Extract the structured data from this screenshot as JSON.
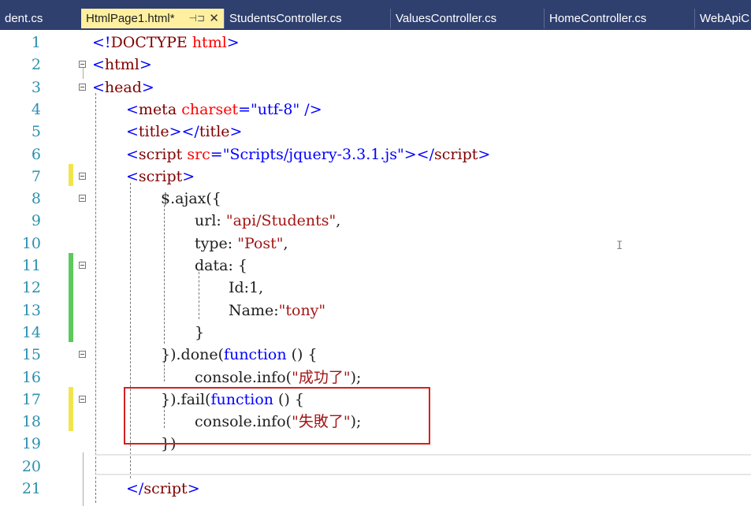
{
  "tabs": [
    {
      "label": "dent.cs",
      "active": false
    },
    {
      "label": "HtmlPage1.html*",
      "active": true
    },
    {
      "label": "StudentsController.cs",
      "active": false
    },
    {
      "label": "ValuesController.cs",
      "active": false
    },
    {
      "label": "HomeController.cs",
      "active": false
    },
    {
      "label": "WebApiC",
      "active": false
    }
  ],
  "tab_icons": {
    "pin": "pin-icon",
    "close": "close-icon"
  },
  "colors": {
    "tab_background": "#2f3f6e",
    "active_tab": "#fff0a0",
    "line_number": "#2b91af",
    "tag": "#0000ff",
    "tag_name": "#800000",
    "attribute": "#ff0000",
    "keyword": "#0000ff",
    "string": "#a31515",
    "modified_unsaved": "#f2e54c",
    "modified_saved": "#5cc95c",
    "highlight_box": "#d42020"
  },
  "code": {
    "line_numbers": [
      "1",
      "2",
      "3",
      "4",
      "5",
      "6",
      "7",
      "8",
      "9",
      "10",
      "11",
      "12",
      "13",
      "14",
      "15",
      "16",
      "17",
      "18",
      "19",
      "20",
      "21"
    ],
    "lines": [
      [
        {
          "t": "<!",
          "c": "t"
        },
        {
          "t": "DOCTYPE",
          "c": "tn"
        },
        {
          "t": " html",
          "c": "at"
        },
        {
          "t": ">",
          "c": "t"
        }
      ],
      [
        {
          "t": "<",
          "c": "t"
        },
        {
          "t": "html",
          "c": "tn"
        },
        {
          "t": ">",
          "c": "t"
        }
      ],
      [
        {
          "t": "<",
          "c": "t"
        },
        {
          "t": "head",
          "c": "tn"
        },
        {
          "t": ">",
          "c": "t"
        }
      ],
      [
        {
          "t": "<",
          "c": "t"
        },
        {
          "t": "meta",
          "c": "tn"
        },
        {
          "t": " charset",
          "c": "at"
        },
        {
          "t": "=",
          "c": "t"
        },
        {
          "t": "\"utf-8\"",
          "c": "av"
        },
        {
          "t": " />",
          "c": "t"
        }
      ],
      [
        {
          "t": "<",
          "c": "t"
        },
        {
          "t": "title",
          "c": "tn"
        },
        {
          "t": "></",
          "c": "t"
        },
        {
          "t": "title",
          "c": "tn"
        },
        {
          "t": ">",
          "c": "t"
        }
      ],
      [
        {
          "t": "<",
          "c": "t"
        },
        {
          "t": "script",
          "c": "tn"
        },
        {
          "t": " src",
          "c": "at"
        },
        {
          "t": "=",
          "c": "t"
        },
        {
          "t": "\"Scripts/jquery-3.3.1.js\"",
          "c": "av"
        },
        {
          "t": "></",
          "c": "t"
        },
        {
          "t": "script",
          "c": "tn"
        },
        {
          "t": ">",
          "c": "t"
        }
      ],
      [
        {
          "t": "<",
          "c": "t"
        },
        {
          "t": "script",
          "c": "tn"
        },
        {
          "t": ">",
          "c": "t"
        }
      ],
      [
        {
          "t": "$.ajax({",
          "c": ""
        }
      ],
      [
        {
          "t": "url: ",
          "c": ""
        },
        {
          "t": "\"api/Students\"",
          "c": "st"
        },
        {
          "t": ",",
          "c": ""
        }
      ],
      [
        {
          "t": "type: ",
          "c": ""
        },
        {
          "t": "\"Post\"",
          "c": "st"
        },
        {
          "t": ",",
          "c": ""
        }
      ],
      [
        {
          "t": "data: {",
          "c": ""
        }
      ],
      [
        {
          "t": "Id:1,",
          "c": ""
        }
      ],
      [
        {
          "t": "Name:",
          "c": ""
        },
        {
          "t": "\"tony\"",
          "c": "st"
        }
      ],
      [
        {
          "t": "}",
          "c": ""
        }
      ],
      [
        {
          "t": "}).done(",
          "c": ""
        },
        {
          "t": "function",
          "c": "kw"
        },
        {
          "t": " () {",
          "c": ""
        }
      ],
      [
        {
          "t": "console.info(",
          "c": ""
        },
        {
          "t": "\"成功了\"",
          "c": "st"
        },
        {
          "t": ");",
          "c": ""
        }
      ],
      [
        {
          "t": "}).fail(",
          "c": ""
        },
        {
          "t": "function",
          "c": "kw"
        },
        {
          "t": " () {",
          "c": ""
        }
      ],
      [
        {
          "t": "console.info(",
          "c": ""
        },
        {
          "t": "\"失敗了\"",
          "c": "st"
        },
        {
          "t": ");",
          "c": ""
        }
      ],
      [
        {
          "t": "})",
          "c": ""
        }
      ],
      [],
      [
        {
          "t": "</",
          "c": "t"
        },
        {
          "t": "script",
          "c": "tn"
        },
        {
          "t": ">",
          "c": "t"
        }
      ]
    ]
  }
}
